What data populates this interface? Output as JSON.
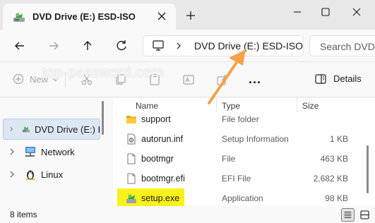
{
  "tab": {
    "title": "DVD Drive (E:) ESD-ISO",
    "icon": "dvd-drive-icon"
  },
  "window_controls": [
    "minimize",
    "maximize",
    "close"
  ],
  "navigation": {
    "buttons": [
      "back",
      "forward",
      "up",
      "refresh"
    ],
    "address": "DVD Drive (E:) ESD-ISO",
    "search_placeholder": "Search DVD Drive (E:) ESD-ISO"
  },
  "commandbar": {
    "new_label": "New",
    "more_label": "...",
    "details_label": "Details"
  },
  "watermark": "top-password.com",
  "sidebar": {
    "items": [
      {
        "label": "DVD Drive (E:) ESD-ISO",
        "icon": "dvd-drive-icon",
        "selected": true
      },
      {
        "label": "Network",
        "icon": "network-icon",
        "selected": false
      },
      {
        "label": "Linux",
        "icon": "linux-icon",
        "selected": false
      }
    ]
  },
  "file_list": {
    "columns": {
      "name": "Name",
      "type": "Type",
      "size": "Size"
    },
    "rows": [
      {
        "name": "support",
        "type": "File folder",
        "size": "",
        "icon": "folder-icon"
      },
      {
        "name": "autorun.inf",
        "type": "Setup Information",
        "size": "1 KB",
        "icon": "settings-file-icon"
      },
      {
        "name": "bootmgr",
        "type": "File",
        "size": "463 KB",
        "icon": "file-icon"
      },
      {
        "name": "bootmgr.efi",
        "type": "EFI File",
        "size": "2,682 KB",
        "icon": "file-icon"
      },
      {
        "name": "setup.exe",
        "type": "Application",
        "size": "98 KB",
        "icon": "setup-exe-icon",
        "highlighted": true
      }
    ]
  },
  "statusbar": {
    "item_count": "8 items"
  },
  "colors": {
    "highlight": "#f9f11a",
    "arrow": "#f6a24a",
    "selection": "#dde7f3"
  }
}
